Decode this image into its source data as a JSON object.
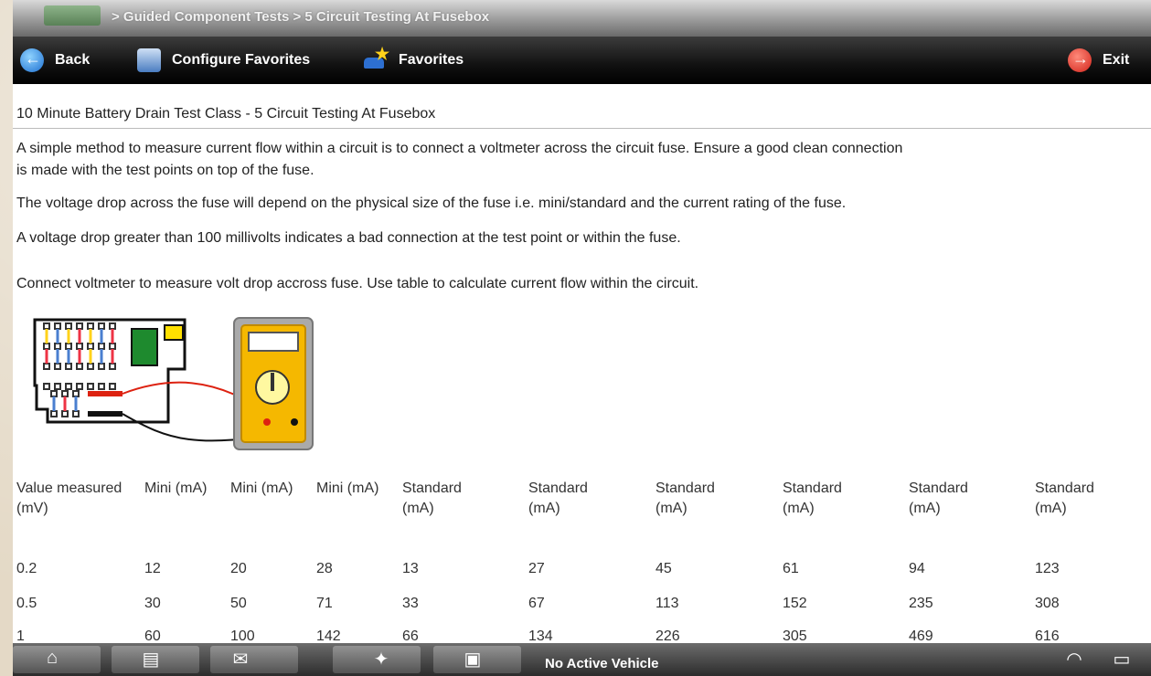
{
  "breadcrumb": {
    "text": "> Guided Component Tests   > 5 Circuit Testing At Fusebox"
  },
  "toolbar": {
    "back_label": "Back",
    "configure_label": "Configure Favorites",
    "favorites_label": "Favorites",
    "exit_label": "Exit"
  },
  "content": {
    "title": "10 Minute Battery Drain Test Class - 5 Circuit Testing At Fusebox",
    "para1_line1": "A simple method to measure current flow within a circuit is to connect a voltmeter across the circuit fuse. Ensure a good clean connection",
    "para1_line2": "is made with the test points on top of the fuse.",
    "para2": "The voltage drop across the fuse will depend on the physical size of the fuse i.e. mini/standard and the current rating of the fuse.",
    "para3": "A voltage drop greater than 100 millivolts indicates a bad connection at the test point or within the fuse.",
    "para4": "Connect voltmeter to measure volt drop accross fuse. Use table to calculate current flow within the circuit."
  },
  "table": {
    "headers": [
      "Value measured (mV)",
      "Mini (mA)",
      "Mini (mA)",
      "Mini (mA)",
      "Standard (mA)",
      "Standard (mA)",
      "Standard (mA)",
      "Standard (mA)",
      "Standard (mA)",
      "Standard (mA)"
    ],
    "rows": [
      [
        "0.2",
        "12",
        "20",
        "28",
        "13",
        "27",
        "45",
        "61",
        "94",
        "123"
      ],
      [
        "0.5",
        "30",
        "50",
        "71",
        "33",
        "67",
        "113",
        "152",
        "235",
        "308"
      ],
      [
        "1",
        "60",
        "100",
        "142",
        "66",
        "134",
        "226",
        "305",
        "469",
        "616"
      ]
    ]
  },
  "taskbar": {
    "status": "No Active Vehicle"
  },
  "icons": [
    "home-icon",
    "data-icon",
    "tools-icon",
    "scanner-icon",
    "vehicle-icon",
    "wifi-icon",
    "battery-icon"
  ]
}
